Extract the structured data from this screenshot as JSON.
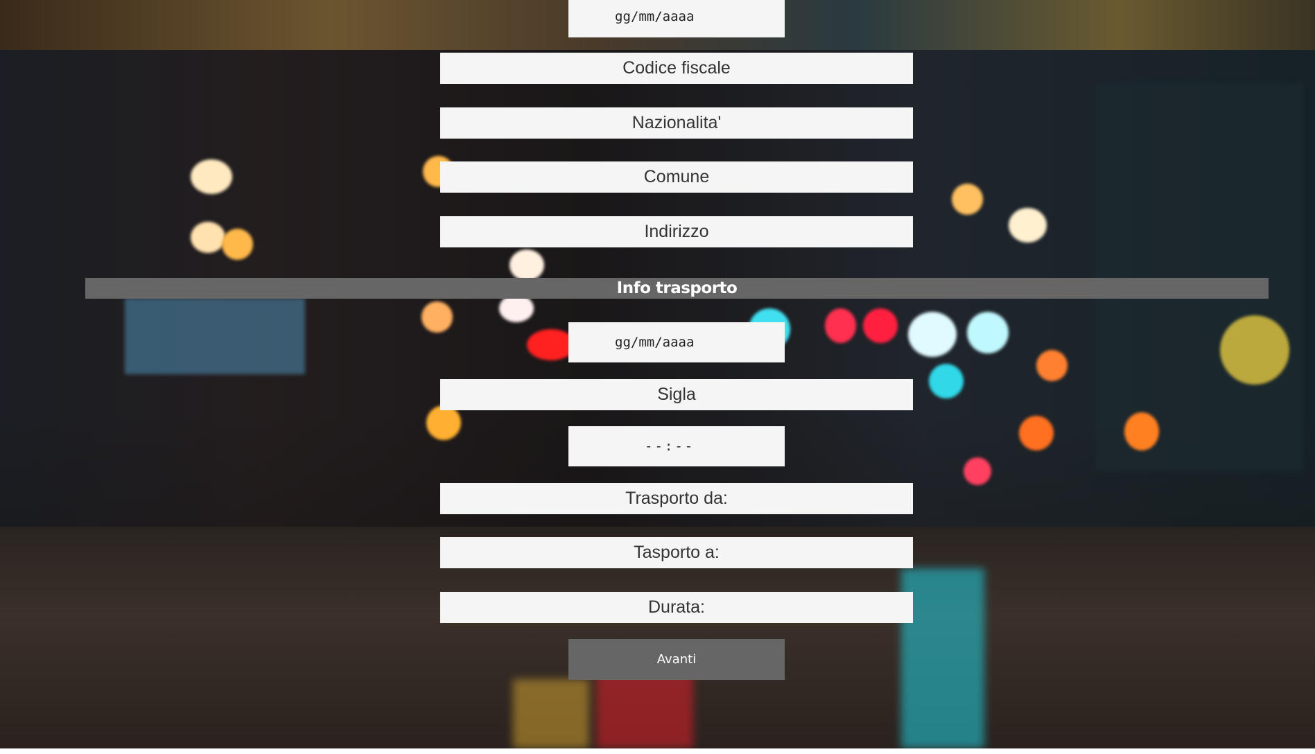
{
  "form": {
    "date_placeholder_1": "gg/mm/aaaa",
    "codice_fiscale": "Codice fiscale",
    "nazionalita": "Nazionalita'",
    "comune": "Comune",
    "indirizzo": "Indirizzo",
    "section_title": "Info trasporto",
    "date_placeholder_2": "gg/mm/aaaa",
    "sigla": "Sigla",
    "time_placeholder": "--:--",
    "trasporto_da": "Trasporto da:",
    "trasporto_a": "Tasporto a:",
    "durata": "Durata:",
    "avanti_label": "Avanti"
  },
  "colors": {
    "field_bg": "#f5f5f5",
    "section_bar_bg": "#666666",
    "button_bg": "#666666",
    "text": "#333333",
    "light_text": "#ffffff"
  }
}
